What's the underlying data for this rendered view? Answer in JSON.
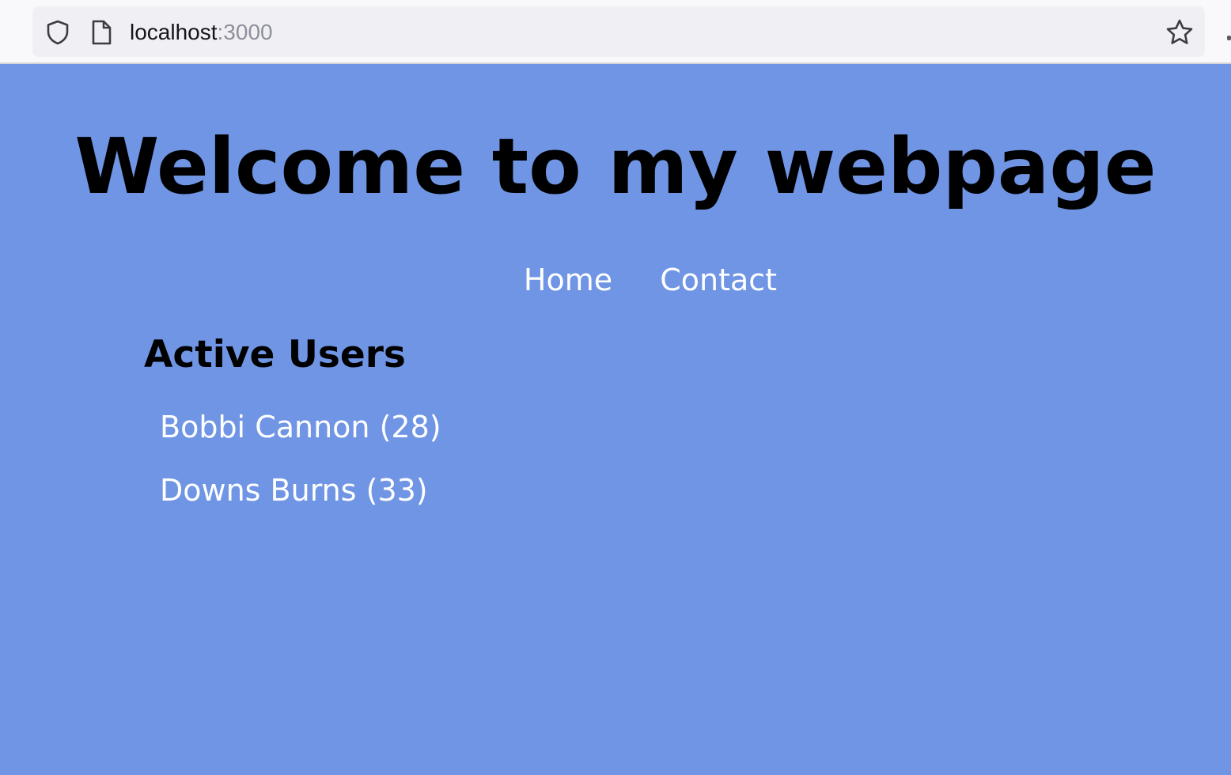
{
  "browser": {
    "url_host": "localhost",
    "url_port": ":3000",
    "icons": [
      "shield-icon",
      "page-icon",
      "star-icon"
    ]
  },
  "page": {
    "background": "#6f95e4",
    "title": "Welcome to my webpage",
    "nav": [
      {
        "label": "Home"
      },
      {
        "label": "Contact"
      }
    ],
    "section_title": "Active Users",
    "users": [
      {
        "label": "Bobbi Cannon (28)"
      },
      {
        "label": "Downs Burns (33)"
      }
    ]
  }
}
